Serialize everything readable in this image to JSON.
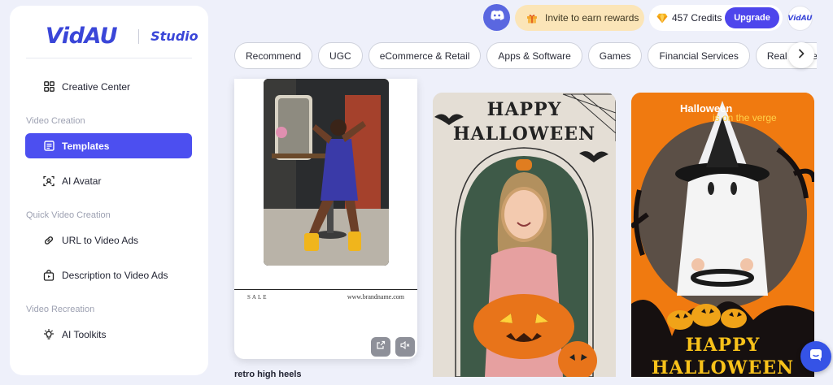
{
  "brand": {
    "logo": "VidAU",
    "product": "Studio"
  },
  "sidebar": {
    "creative_center": "Creative Center",
    "sections": [
      {
        "label": "Video Creation",
        "items": [
          {
            "label": "Templates",
            "icon": "templates-icon",
            "active": true
          },
          {
            "label": "AI Avatar",
            "icon": "avatar-icon"
          }
        ]
      },
      {
        "label": "Quick Video Creation",
        "items": [
          {
            "label": "URL to Video Ads",
            "icon": "link-icon"
          },
          {
            "label": "Description to Video Ads",
            "icon": "bag-icon"
          }
        ]
      },
      {
        "label": "Video Recreation",
        "items": [
          {
            "label": "AI Toolkits",
            "icon": "bulb-icon"
          }
        ]
      }
    ]
  },
  "topbar": {
    "invite": "Invite to earn rewards",
    "credits": "457 Credits",
    "upgrade": "Upgrade",
    "avatar_text": "VidAU"
  },
  "categories": [
    "Recommend",
    "UGC",
    "eCommerce & Retail",
    "Apps & Software",
    "Games",
    "Financial Services",
    "Real Estate"
  ],
  "cards": [
    {
      "title": "retro high heels",
      "sale_text": "SALE",
      "brandname": "www.brandname.com"
    },
    {
      "headline_line1": "HAPPY",
      "headline_line2": "HALLOWEEN"
    },
    {
      "top_text": "Halloween",
      "sub_text": "is on the verge",
      "headline_line1": "HAPPY",
      "headline_line2": "HALLOWEEN"
    }
  ],
  "colors": {
    "accent": "#4c4ff0",
    "brand": "#3a46d8",
    "invite_bg": "#fbe5b8",
    "halloween_orange": "#f07a10"
  }
}
